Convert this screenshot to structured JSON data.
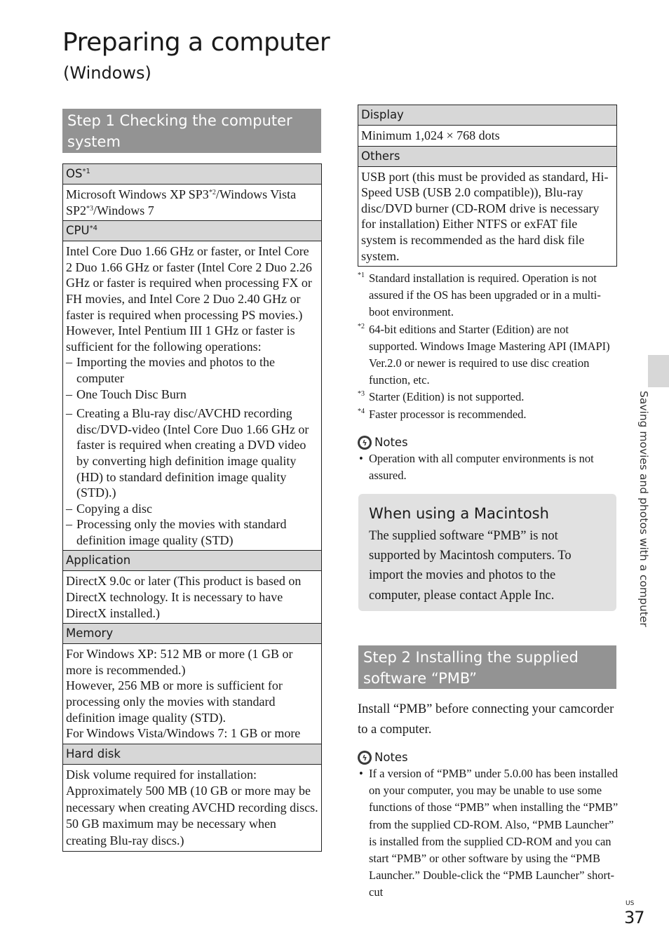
{
  "page": {
    "title": "Preparing a computer",
    "subtitle": "(Windows)",
    "side_label": "Saving movies and photos with a computer",
    "page_region": "US",
    "page_number": "37"
  },
  "step1": {
    "header": "Step 1  Checking the computer system"
  },
  "left_table": {
    "os": {
      "header": "OS",
      "header_sup": "*1",
      "body_part1": "Microsoft Windows XP SP3",
      "sup2": "*2",
      "body_part2": "/Windows Vista SP2",
      "sup3": "*3",
      "body_part3": "/Windows 7"
    },
    "cpu": {
      "header": "CPU",
      "header_sup": "*4",
      "paragraph1": "Intel Core Duo 1.66 GHz or faster, or Intel Core 2 Duo 1.66 GHz or faster (Intel Core 2 Duo 2.26 GHz or faster is required when processing FX or FH movies, and Intel Core 2 Duo 2.40 GHz or faster is required when processing PS movies.)",
      "paragraph2": "However, Intel Pentium III 1 GHz or faster is sufficient for the following operations:",
      "items": [
        "Importing the movies and photos to the computer",
        "One Touch Disc Burn",
        "Creating a Blu-ray disc/AVCHD recording disc/DVD-video (Intel Core Duo 1.66 GHz or faster is required when creating a DVD video by converting high definition image quality (HD) to standard definition image quality (STD).)",
        "Copying a disc",
        "Processing only the movies with standard definition image quality (STD)"
      ]
    },
    "application": {
      "header": "Application",
      "body": "DirectX 9.0c or later (This product is based on DirectX technology. It is necessary to have DirectX installed.)"
    },
    "memory": {
      "header": "Memory",
      "line1": "For Windows XP: 512 MB or more (1 GB or more is recommended.)",
      "line2": "However, 256 MB or more is sufficient for processing only the movies with standard definition image quality (STD).",
      "line3": "For Windows Vista/Windows 7: 1 GB or more"
    },
    "hard_disk": {
      "header": "Hard disk",
      "body": "Disk volume required for installation: Approximately 500 MB (10 GB or more may be necessary when creating AVCHD recording discs. 50 GB maximum may be necessary when creating Blu-ray discs.)"
    }
  },
  "right_table": {
    "display": {
      "header": "Display",
      "body": "Minimum 1,024 × 768 dots"
    },
    "others": {
      "header": "Others",
      "body": "USB port (this must be provided as standard, Hi-Speed USB (USB 2.0 compatible)), Blu-ray disc/DVD burner (CD-ROM drive is necessary for installation) Either NTFS or exFAT file system is recommended as the hard disk file system."
    }
  },
  "footnotes": [
    {
      "mark": "*1",
      "text": "Standard installation is required. Operation is not assured if the OS has been upgraded or in a multi-boot environment."
    },
    {
      "mark": "*2",
      "text": "64-bit editions and Starter (Edition) are not supported. Windows Image Mastering API (IMAPI) Ver.2.0 or newer is required to use disc creation function, etc."
    },
    {
      "mark": "*3",
      "text": "Starter (Edition) is not supported."
    },
    {
      "mark": "*4",
      "text": "Faster processor is recommended."
    }
  ],
  "notes1": {
    "label": "Notes",
    "icon": "notes-lightning-icon",
    "items": [
      "Operation with all computer environments is not assured."
    ]
  },
  "macintosh": {
    "title": "When using a Macintosh",
    "body": "The supplied software “PMB” is not supported by Macintosh computers. To import the movies and photos to the computer, please contact Apple Inc."
  },
  "step2": {
    "header": "Step 2  Installing the supplied software “PMB”",
    "intro": "Install “PMB” before connecting your camcorder to a computer."
  },
  "notes2": {
    "label": "Notes",
    "icon": "notes-lightning-icon",
    "items": [
      "If a version of “PMB” under 5.0.00 has been installed on your computer, you may be unable to use some functions of those “PMB” when installing the “PMB” from the supplied CD-ROM. Also, “PMB Launcher” is installed from the supplied CD-ROM and you can start “PMB” or other software by using the “PMB Launcher.” Double-click the “PMB Launcher” short-cut"
    ]
  },
  "colors": {
    "step_header_bg": "#939393",
    "table_header_bg": "#d7d7d7",
    "mac_box_bg": "#e1e1e1"
  }
}
